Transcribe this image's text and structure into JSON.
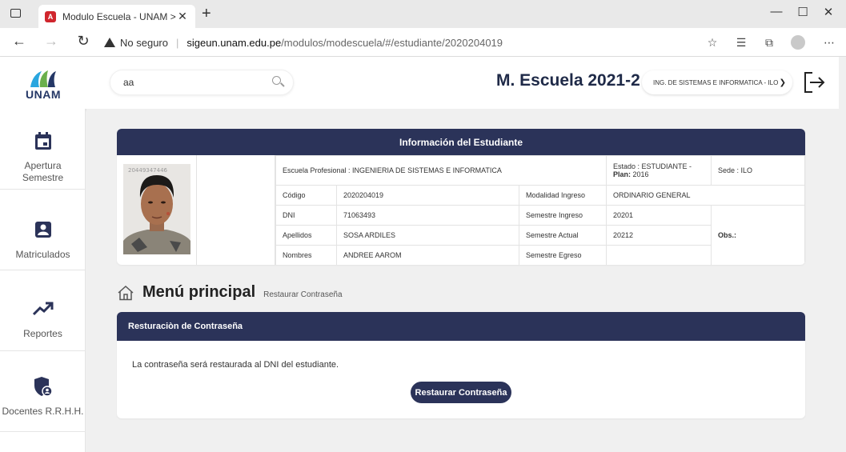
{
  "browser": {
    "tab_title": "Modulo Escuela - UNAM >>",
    "tab_favicon": "A",
    "security_label": "No seguro",
    "url_host": "sigeun.unam.edu.pe",
    "url_path": "/modulos/modescuela/#/estudiante/2020204019",
    "icons": [
      "tab-actions-icon",
      "back-icon",
      "forward-icon",
      "refresh-icon",
      "warning-icon",
      "favorites-add-icon",
      "favorites-icon",
      "collections-icon",
      "profile-icon",
      "more-icon",
      "minimize-icon",
      "maximize-icon",
      "close-icon"
    ]
  },
  "header": {
    "logo_text": "UNAM",
    "search_value": "aa",
    "title": "M. Escuela 2021-2",
    "school_selected": "ING. DE SISTEMAS E INFORMATICA - ILO"
  },
  "sidebar": {
    "items": [
      {
        "label": "Apertura Semestre",
        "icon": "calendar-icon"
      },
      {
        "label": "Matriculados",
        "icon": "user-badge-icon"
      },
      {
        "label": "Reportes",
        "icon": "trending-up-icon"
      },
      {
        "label": "Docentes R.R.H.H.",
        "icon": "shield-user-icon"
      }
    ]
  },
  "student": {
    "card_title": "Información del Estudiante",
    "escuela": "Escuela Profesional : INGENIERIA DE SISTEMAS E INFORMATICA",
    "estado": "Estado : ESTUDIANTE -",
    "plan_label": "Plan:",
    "plan_value": "2016",
    "sede": "Sede : ILO",
    "rows": {
      "codigo_label": "Código",
      "codigo": "2020204019",
      "dni_label": "DNI",
      "dni": "71063493",
      "apellidos_label": "Apellidos",
      "apellidos": "SOSA ARDILES",
      "nombres_label": "Nombres",
      "nombres": "ANDREE AAROM",
      "modalidad_label": "Modalidad Ingreso",
      "modalidad": "ORDINARIO GENERAL",
      "sem_ingreso_label": "Semestre Ingreso",
      "sem_ingreso": "20201",
      "sem_actual_label": "Semestre Actual",
      "sem_actual": "20212",
      "sem_egreso_label": "Semestre Egreso",
      "sem_egreso": "",
      "obs_label": "Obs.:"
    },
    "photo_watermark": "20449347446"
  },
  "menu": {
    "title": "Menú principal",
    "breadcrumb": "Restaurar Contraseña"
  },
  "reset": {
    "header": "Resturaciòn de Contraseña",
    "message": "La contraseña será restaurada al DNI del estudiante.",
    "button_label": "Restaurar Contraseña"
  },
  "colors": {
    "navy": "#2b3359",
    "title": "#1f2a48",
    "logo_blue": "#243766"
  }
}
